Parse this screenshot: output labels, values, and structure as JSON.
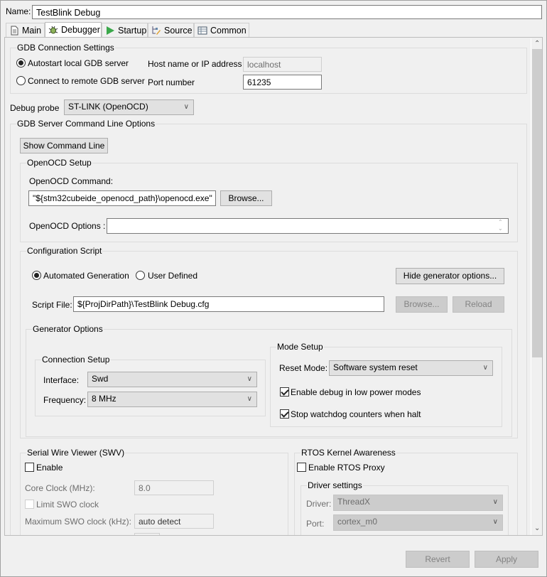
{
  "name_label": "Name:",
  "name_value": "TestBlink Debug",
  "tabs": [
    {
      "label": "Main",
      "icon": "document-icon"
    },
    {
      "label": "Debugger",
      "icon": "bug-icon",
      "active": true
    },
    {
      "label": "Startup",
      "icon": "play-icon"
    },
    {
      "label": "Source",
      "icon": "source-tree-icon"
    },
    {
      "label": "Common",
      "icon": "table-icon"
    }
  ],
  "gdb": {
    "title": "GDB Connection Settings",
    "autostart": "Autostart local GDB server",
    "remote": "Connect to remote GDB server",
    "selected": "autostart",
    "host_label": "Host name or IP address",
    "host_value": "localhost",
    "port_label": "Port number",
    "port_value": "61235"
  },
  "probe": {
    "label": "Debug probe",
    "value": "ST-LINK (OpenOCD)"
  },
  "server": {
    "title": "GDB Server Command Line Options",
    "show_cmd": "Show Command Line"
  },
  "openocd": {
    "title": "OpenOCD Setup",
    "cmd_label": "OpenOCD Command:",
    "cmd_value": "\"${stm32cubeide_openocd_path}\\openocd.exe\"",
    "browse": "Browse...",
    "options_label": "OpenOCD Options :",
    "options_value": ""
  },
  "config": {
    "title": "Configuration Script",
    "auto": "Automated Generation",
    "user": "User Defined",
    "selected": "auto",
    "hide_gen": "Hide generator options...",
    "script_label": "Script File:",
    "script_value": "${ProjDirPath}\\TestBlink Debug.cfg",
    "browse": "Browse...",
    "reload": "Reload"
  },
  "generator": {
    "title": "Generator Options",
    "connection": {
      "title": "Connection Setup",
      "interface_label": "Interface:",
      "interface_value": "Swd",
      "frequency_label": "Frequency:",
      "frequency_value": "8 MHz"
    },
    "mode": {
      "title": "Mode Setup",
      "reset_label": "Reset Mode:",
      "reset_value": "Software system reset",
      "low_power": "Enable debug in low power modes",
      "low_power_checked": true,
      "watchdog": "Stop watchdog counters when halt",
      "watchdog_checked": true
    }
  },
  "swv": {
    "title": "Serial Wire Viewer (SWV)",
    "enable": "Enable",
    "enable_checked": false,
    "core_clock_label": "Core Clock (MHz):",
    "core_clock_value": "8.0",
    "limit_swo": "Limit SWO clock",
    "max_swo_label": "Maximum SWO clock (kHz):",
    "max_swo_value": "auto detect"
  },
  "rtos": {
    "title": "RTOS Kernel Awareness",
    "enable": "Enable RTOS Proxy",
    "enable_checked": false,
    "driver_title": "Driver settings",
    "driver_label": "Driver:",
    "driver_value": "ThreadX",
    "port_label": "Port:",
    "port_value": "cortex_m0"
  },
  "footer": {
    "revert": "Revert",
    "apply": "Apply"
  }
}
